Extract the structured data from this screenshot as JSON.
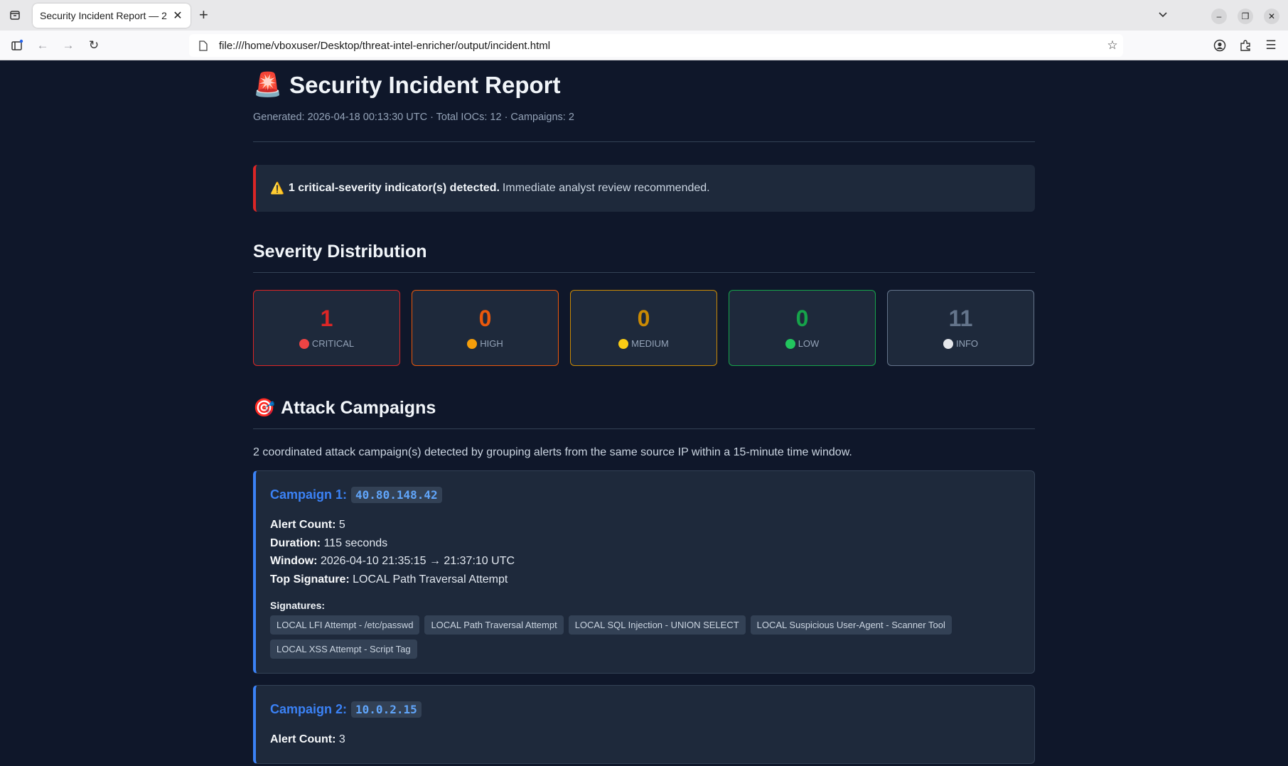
{
  "browser": {
    "tab_title": "Security Incident Report — 2",
    "url": "file:///home/vboxuser/Desktop/threat-intel-enricher/output/incident.html"
  },
  "report": {
    "icon": "🚨",
    "title": "Security Incident Report",
    "meta": "Generated: 2026-04-18 00:13:30 UTC · Total IOCs: 12 · Campaigns: 2",
    "alert": {
      "icon": "⚠️",
      "bold": "1 critical-severity indicator(s) detected.",
      "text": "Immediate analyst review recommended."
    },
    "severity_heading": "Severity Distribution",
    "severity": [
      {
        "count": "1",
        "label": "CRITICAL",
        "color": "#dc2626",
        "dot": "#ef4444"
      },
      {
        "count": "0",
        "label": "HIGH",
        "color": "#ea580c",
        "dot": "#f59e0b"
      },
      {
        "count": "0",
        "label": "MEDIUM",
        "color": "#ca8a04",
        "dot": "#facc15"
      },
      {
        "count": "0",
        "label": "LOW",
        "color": "#16a34a",
        "dot": "#22c55e"
      },
      {
        "count": "11",
        "label": "INFO",
        "color": "#64748b",
        "dot": "#e5e7eb"
      }
    ],
    "campaigns_icon": "🎯",
    "campaigns_heading": "Attack Campaigns",
    "campaigns_desc": "2 coordinated attack campaign(s) detected by grouping alerts from the same source IP within a 15-minute time window.",
    "campaigns": [
      {
        "label": "Campaign 1:",
        "ip": "40.80.148.42",
        "alert_count_label": "Alert Count:",
        "alert_count": "5",
        "duration_label": "Duration:",
        "duration": "115 seconds",
        "window_label": "Window:",
        "window": "2026-04-10 21:35:15 → 21:37:10 UTC",
        "top_sig_label": "Top Signature:",
        "top_sig": "LOCAL Path Traversal Attempt",
        "signatures_label": "Signatures:",
        "signatures": [
          "LOCAL LFI Attempt - /etc/passwd",
          "LOCAL Path Traversal Attempt",
          "LOCAL SQL Injection - UNION SELECT",
          "LOCAL Suspicious User-Agent - Scanner Tool",
          "LOCAL XSS Attempt - Script Tag"
        ]
      },
      {
        "label": "Campaign 2:",
        "ip": "10.0.2.15",
        "alert_count_label": "Alert Count:",
        "alert_count": "3"
      }
    ]
  }
}
